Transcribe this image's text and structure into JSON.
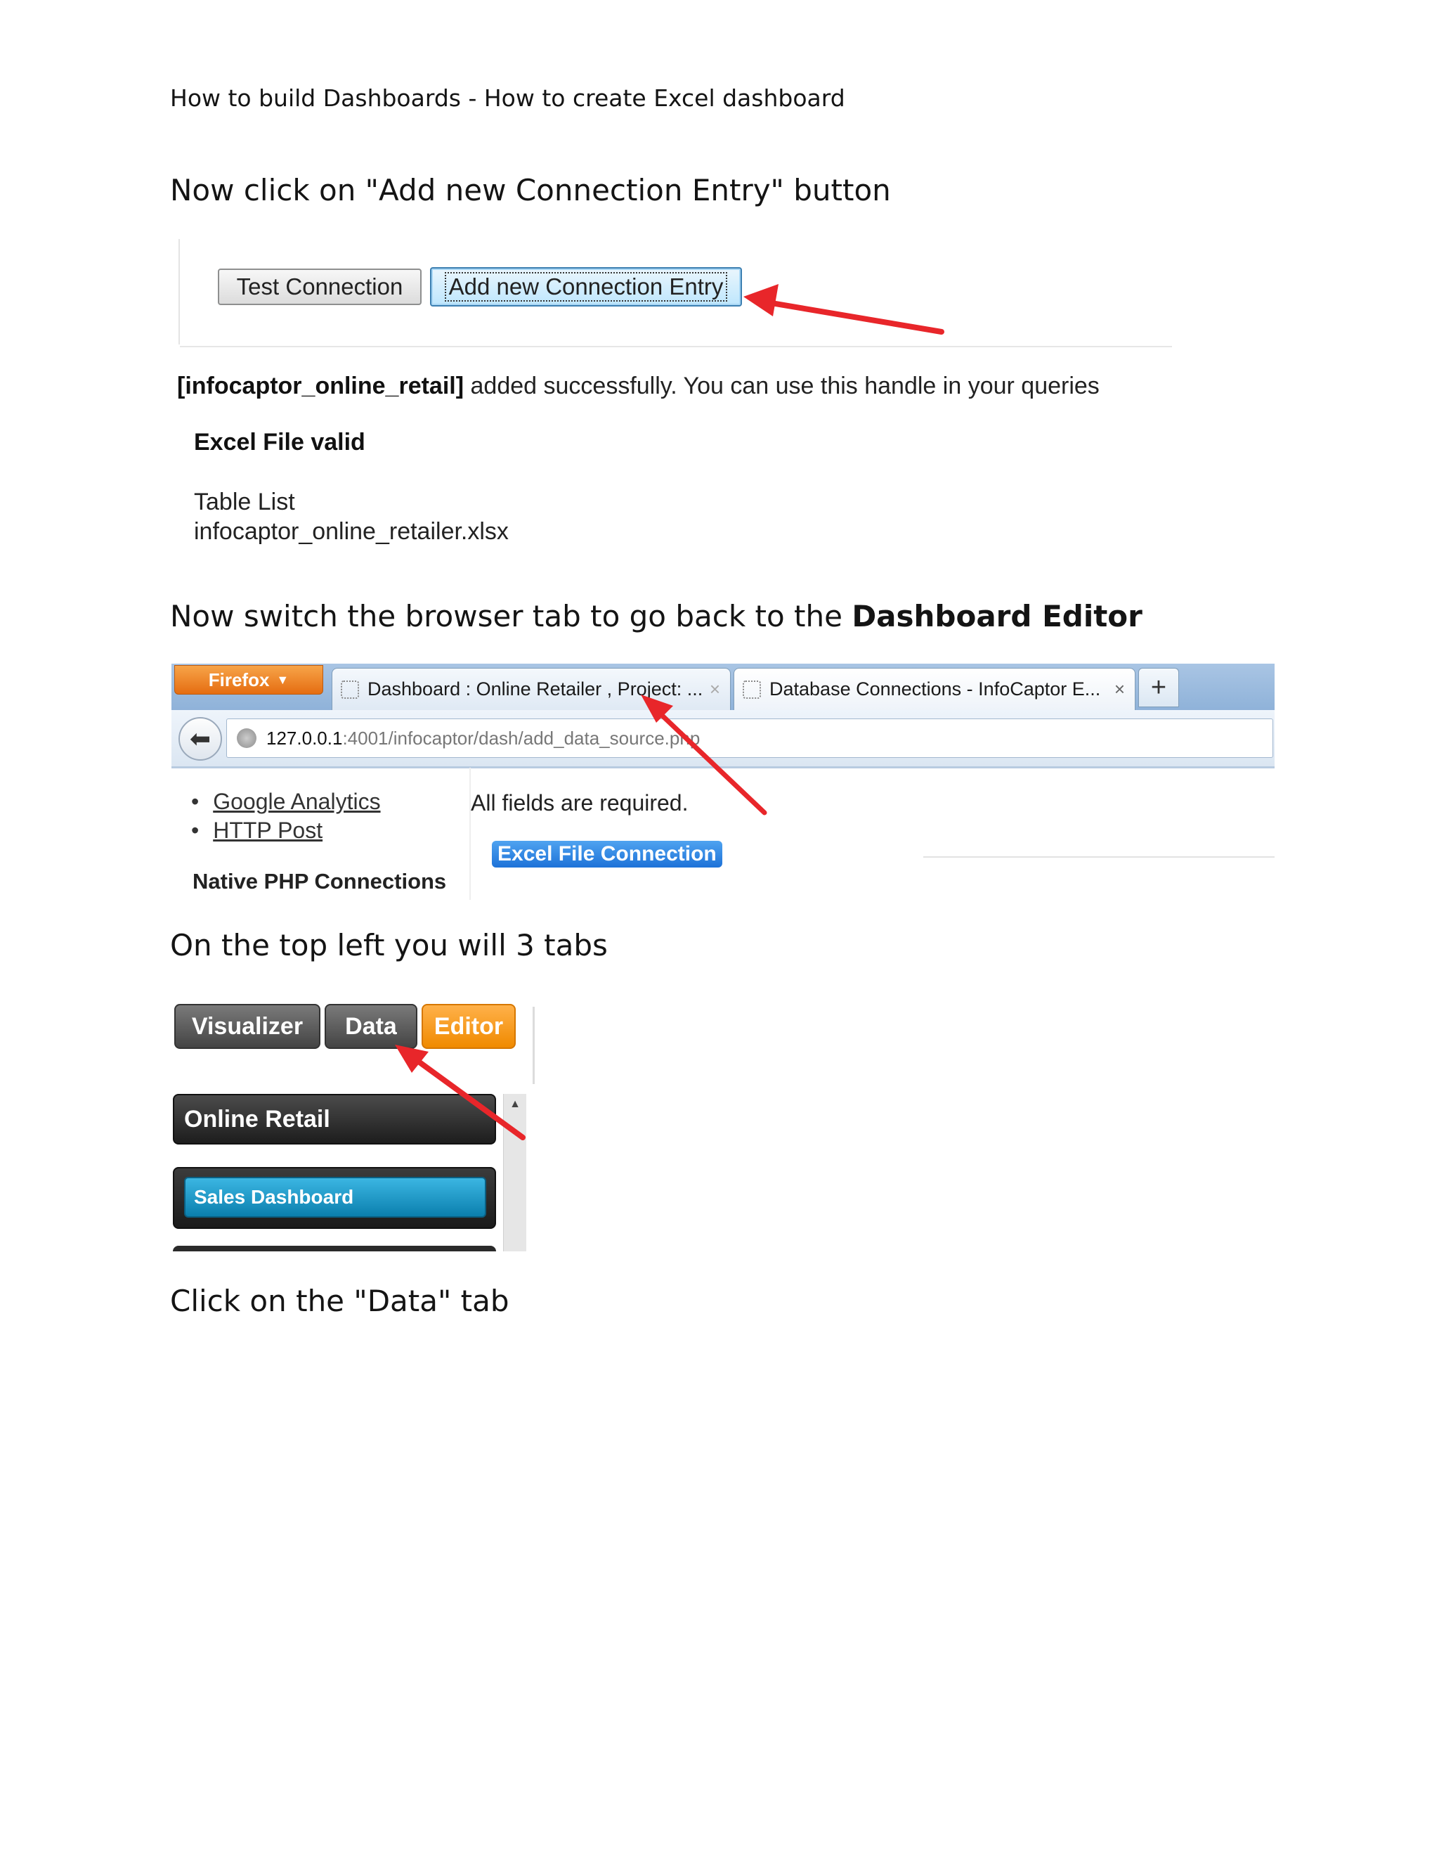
{
  "header": {
    "title": "How to build Dashboards - How to create Excel dashboard"
  },
  "steps": {
    "step1": "Now click on \"Add new Connection Entry\" button",
    "step2_prefix": "Now switch the browser tab to go back to the ",
    "step2_bold": "Dashboard Editor",
    "step3": "On the top left you will 3 tabs",
    "step4": "Click on the \"Data\" tab"
  },
  "shot1": {
    "test_button": "Test Connection",
    "add_button": "Add new Connection Entry",
    "success_handle": "[infocaptor_online_retail]",
    "success_rest": " added successfully. You can use this handle in your queries",
    "valid_label": "Excel File valid",
    "table_list_label": "Table List",
    "table_list_file": "infocaptor_online_retailer.xlsx"
  },
  "shot2": {
    "firefox_button": "Firefox",
    "tab1": "Dashboard : Online Retailer , Project: ...",
    "tab2": "Database Connections - InfoCaptor E...",
    "tab_close": "×",
    "new_tab": "+",
    "url_host": "127.0.0.1",
    "url_path": ":4001/infocaptor/dash/add_data_source.php",
    "side_links": [
      "Google Analytics",
      "HTTP Post"
    ],
    "native_php": "Native PHP Connections",
    "all_fields": "All fields are required.",
    "excel_conn": "Excel File Connection"
  },
  "shot3": {
    "tabs": [
      "Visualizer",
      "Data",
      "Editor"
    ],
    "project": "Online Retail",
    "dashboard": "Sales Dashboard"
  },
  "colors": {
    "arrow": "#e8262a",
    "editor_tab": "#f08a00",
    "sales_dashboard": "#0b7fae",
    "firefox": "#e56d11"
  },
  "icons": {
    "back": "left-arrow-icon",
    "globe": "globe-icon",
    "scroll_up": "triangle-up-icon"
  }
}
